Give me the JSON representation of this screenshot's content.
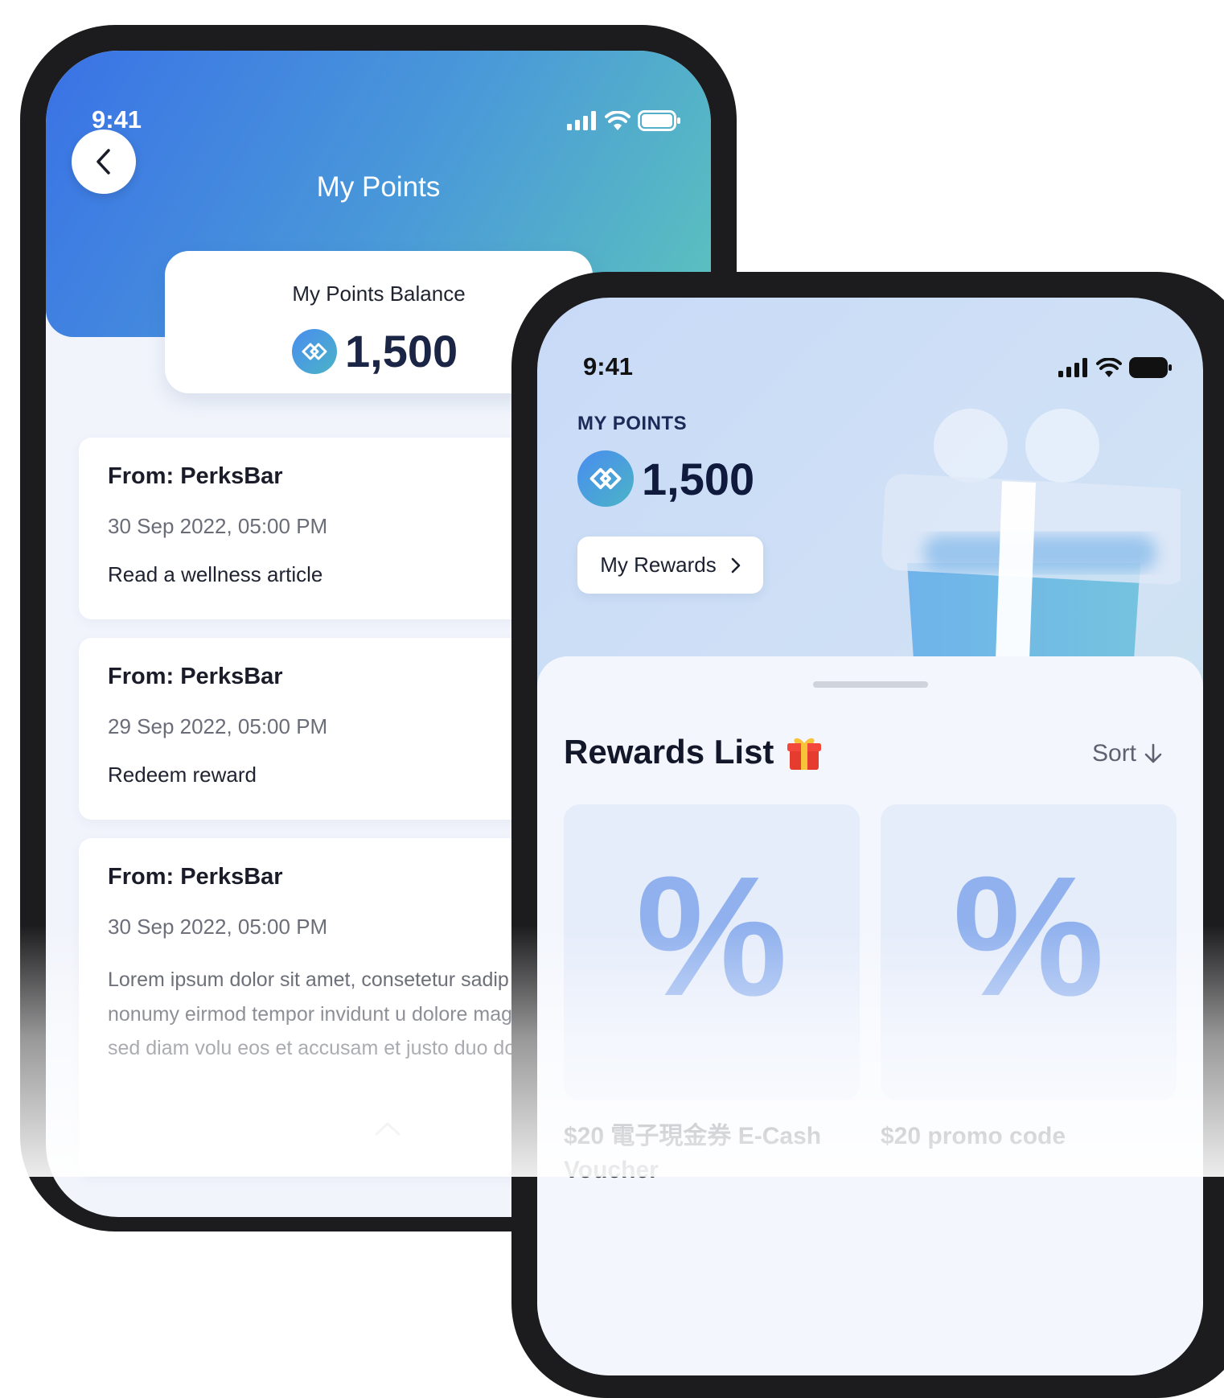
{
  "screen1": {
    "status_time": "9:41",
    "title": "My Points",
    "balance_label": "My Points Balance",
    "balance_value": "1,500",
    "transactions": [
      {
        "from": "From: PerksBar",
        "date": "30 Sep 2022, 05:00 PM",
        "desc": "Read a wellness article"
      },
      {
        "from": "From: PerksBar",
        "date": "29 Sep 2022, 05:00 PM",
        "desc": "Redeem reward"
      },
      {
        "from": "From: PerksBar",
        "date": "30 Sep 2022, 05:00 PM",
        "desc": "Lorem ipsum dolor sit amet, consetetur sadip sed diam nonumy eirmod tempor invidunt u dolore magna aliquyam erat, sed diam volu eos et accusam et justo duo dolores et ea r"
      }
    ]
  },
  "screen2": {
    "status_time": "9:41",
    "points_label": "MY POINTS",
    "points_value": "1,500",
    "rewards_button": "My Rewards",
    "rewards_list_title": "Rewards List",
    "sort_label": "Sort",
    "rewards": [
      {
        "symbol": "%",
        "title": "$20 電子現金券 E-Cash Voucher"
      },
      {
        "symbol": "%",
        "title": "$20 promo code"
      }
    ]
  },
  "colors": {
    "header_gradient_start": "#3a72e6",
    "header_gradient_end": "#5cc3bd",
    "navy_text": "#1b2545",
    "percent_icon": "#90b1ee"
  },
  "icons": [
    "back-chevron-icon",
    "signal-icon",
    "wifi-icon",
    "battery-icon",
    "points-coin-icon",
    "chevron-right-icon",
    "gift-emoji-icon",
    "sort-arrow-icon",
    "chevron-up-icon",
    "gift-illustration"
  ]
}
